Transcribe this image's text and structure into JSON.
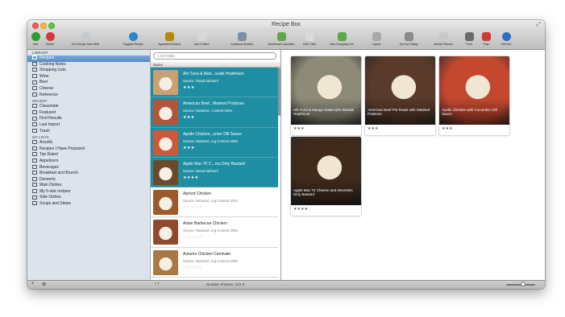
{
  "window": {
    "title": "Recipe Box"
  },
  "toolbar": {
    "buttons": [
      {
        "label": "Add",
        "icon": "add-icon",
        "color": "#2e9c2e"
      },
      {
        "label": "Delete",
        "icon": "delete-icon",
        "color": "#d03a34"
      },
      {
        "label": "Get Recipe from Web",
        "icon": "web-icon",
        "color": "#c5c9cf"
      },
      {
        "label": "Suggest Recipe",
        "icon": "suggest-icon",
        "color": "#2b87c6"
      },
      {
        "label": "Ingredient Search",
        "icon": "ingredient-search-icon",
        "color": "#b8860b"
      },
      {
        "label": "Use Collect",
        "icon": "collect-icon",
        "color": "#d7d7d7"
      },
      {
        "label": "Cookbook Builder",
        "icon": "cookbook-builder-icon",
        "color": "#7f8ea3"
      },
      {
        "label": "Nutritional Calculator",
        "icon": "nutrition-icon",
        "color": "#5fa84a"
      },
      {
        "label": "Chef View",
        "icon": "chef-view-icon",
        "color": "#d9d9d9"
      },
      {
        "label": "New Shopping List",
        "icon": "shopping-list-icon",
        "color": "#5da74a"
      },
      {
        "label": "Layout",
        "icon": "layout-icon",
        "color": "#a8a8a8"
      },
      {
        "label": "Sort by Rating",
        "icon": "sort-icon",
        "color": "#8a8a8a"
      },
      {
        "label": "Mobile Planner",
        "icon": "mobile-planner-icon",
        "color": "#c9c9c9"
      },
      {
        "label": "Print",
        "icon": "print-icon",
        "color": "#6b6b6b"
      },
      {
        "label": "Play",
        "icon": "play-icon",
        "color": "#d13b34"
      },
      {
        "label": "Get Info",
        "icon": "info-icon",
        "color": "#2c6fc6"
      }
    ]
  },
  "sidebar": {
    "sections": [
      {
        "heading": "LIBRARY",
        "items": [
          "Recipes",
          "Cooking Notes",
          "Shopping Lists",
          "Wine",
          "Beer",
          "Cheese",
          "Reference"
        ],
        "selected": 0
      },
      {
        "heading": "RECENT",
        "items": [
          "Classmate",
          "Featured",
          "Find Results",
          "Last Import",
          "Trash"
        ],
        "selected": -1
      },
      {
        "heading": "MY LISTS",
        "items": [
          "Anyolls",
          "Recipes I Have Prepared",
          "Top Rated",
          "Appetizers",
          "Beverages",
          "Breakfast and Brunch",
          "Desserts",
          "Main Dishes",
          "My 5-star recipes",
          "Side Dishes",
          "Soups and Stews"
        ],
        "selected": -1
      }
    ]
  },
  "search": {
    "placeholder": "All Fields"
  },
  "list": {
    "column_header": "Name",
    "rows": [
      {
        "name": "Ahi Tuna & Man...ssabi Heptimum",
        "source": "Source: David Sahsoni",
        "stars": "★★★",
        "selected": true,
        "thumb": "#c9a070"
      },
      {
        "name": "American Beef...Mashed Potatoes",
        "source": "Source: National...Contest 2004",
        "stars": "★★★",
        "selected": true,
        "thumb": "#b3553a"
      },
      {
        "name": "Apollo Chicken...unter Dill Sauce",
        "source": "Source: National...ing Contest 2005",
        "stars": "★★★",
        "selected": true,
        "thumb": "#cb5a3c"
      },
      {
        "name": "Apple Mac 'N' C...rns Dirty Bastard",
        "source": "Source: David Sahsoni",
        "stars": "★★★★",
        "selected": true,
        "thumb": "#6b4a2c"
      },
      {
        "name": "Apricot Chicken",
        "source": "Source: National...ing Contest 2010",
        "stars": "☆☆☆☆☆",
        "selected": false,
        "thumb": "#9c5a2a"
      },
      {
        "name": "Asian Barbecue Chicken",
        "source": "Source: National...ing Contest 2006",
        "stars": "☆☆☆☆☆",
        "selected": false,
        "thumb": "#8f4a2d"
      },
      {
        "name": "Autumn Chicken Carnivale",
        "source": "Source: National...ing Contest 2008",
        "stars": "☆☆☆☆☆",
        "selected": false,
        "thumb": "#a77a45"
      }
    ]
  },
  "cards": [
    {
      "title": "Ahi Tuna & Mango Salad with Wasabi Heptimum",
      "stars": "★★★",
      "color": "#8e8a78"
    },
    {
      "title": "American Beef Pot Roast with Mashed Potatoes",
      "stars": "★★★",
      "color": "#5a3a2a"
    },
    {
      "title": "Apollo Chicken with Cucumber Dill Sauce",
      "stars": "★★★",
      "color": "#c4472f"
    },
    {
      "title": "Apple Mac 'N' Cheese and Alesmiths Dirty Bastard",
      "stars": "★★★★",
      "color": "#3f2a1c"
    }
  ],
  "status": {
    "text": "Number of items: 123 ✕"
  }
}
